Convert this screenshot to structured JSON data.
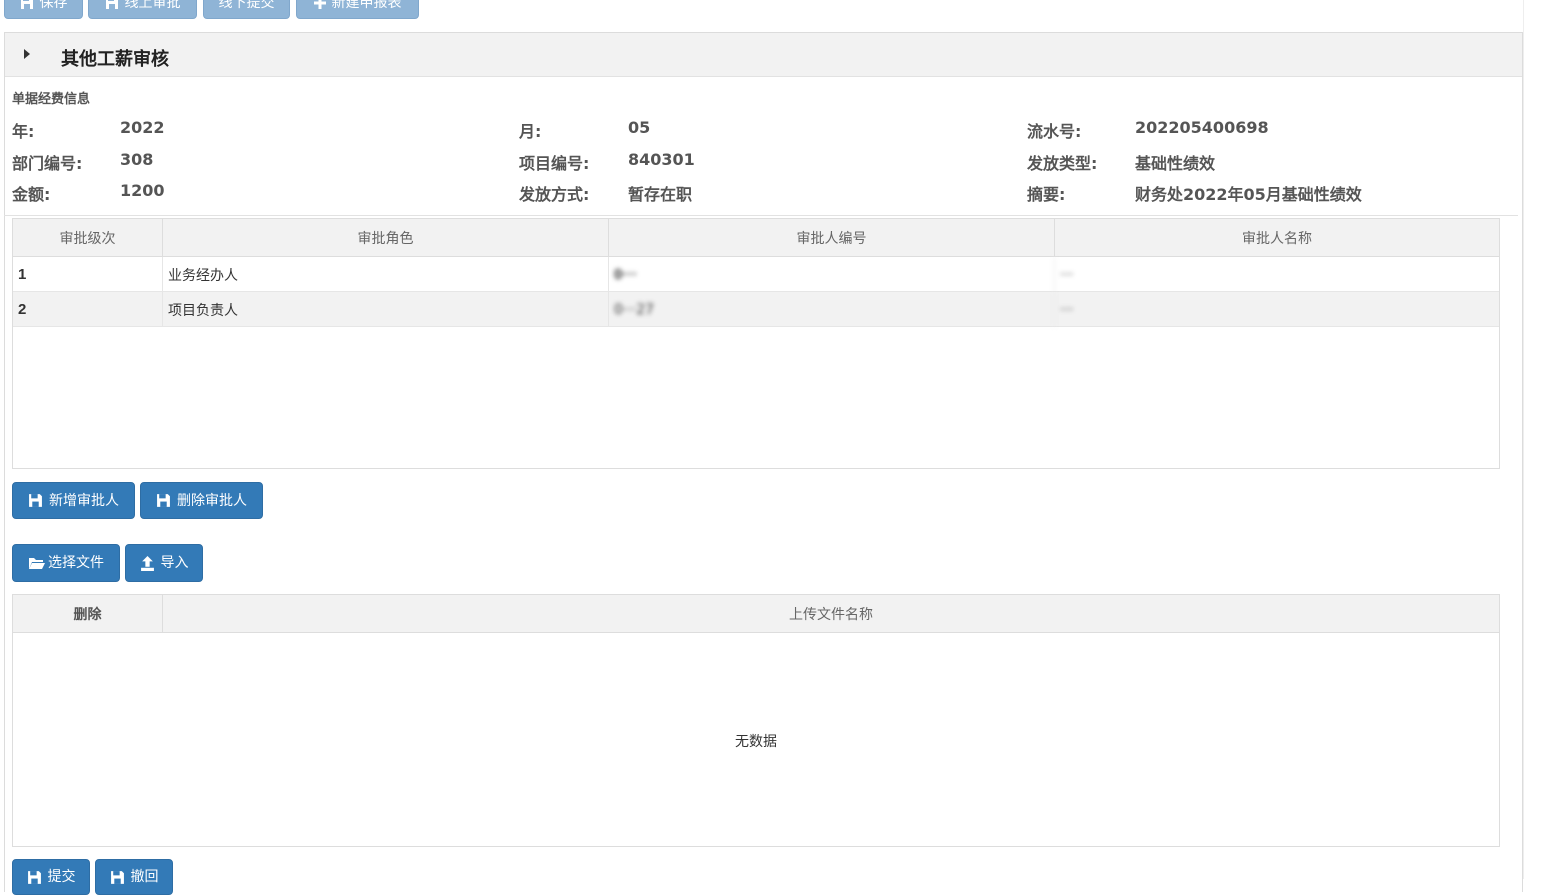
{
  "toolbar": {
    "save_label": "保存",
    "online_approve_label": "线上审批",
    "offline_submit_label": "线下提交",
    "new_report_label": "新建申报表"
  },
  "panel": {
    "title": "其他工薪审核",
    "section_label": "单据经费信息"
  },
  "info": {
    "year_label": "年:",
    "year_value": "2022",
    "month_label": "月:",
    "month_value": "05",
    "serial_label": "流水号:",
    "serial_value": "202205400698",
    "dept_label": "部门编号:",
    "dept_value": "308",
    "project_label": "项目编号:",
    "project_value": "840301",
    "pay_type_label": "发放类型:",
    "pay_type_value": "基础性绩效",
    "amount_label": "金额:",
    "amount_value": "1200",
    "pay_method_label": "发放方式:",
    "pay_method_value": "暂存在职",
    "summary_label": "摘要:",
    "summary_value": "财务处2022年05月基础性绩效"
  },
  "approval_table": {
    "columns": [
      "审批级次",
      "审批角色",
      "审批人编号",
      "审批人名称"
    ],
    "rows": [
      {
        "level": "1",
        "role": "业务经办人",
        "id": "0···",
        "name": "···"
      },
      {
        "level": "2",
        "role": "项目负责人",
        "id": "0···27",
        "name": "···"
      }
    ]
  },
  "approver_buttons": {
    "add_label": "新增审批人",
    "delete_label": "删除审批人"
  },
  "file_buttons": {
    "choose_label": "选择文件",
    "import_label": "导入"
  },
  "file_table": {
    "columns": [
      "删除",
      "上传文件名称"
    ],
    "empty_text": "无数据"
  },
  "footer_buttons": {
    "submit_label": "提交",
    "withdraw_label": "撤回"
  },
  "colors": {
    "primary": "#337ab7",
    "header_bg": "#f2f2f2"
  }
}
